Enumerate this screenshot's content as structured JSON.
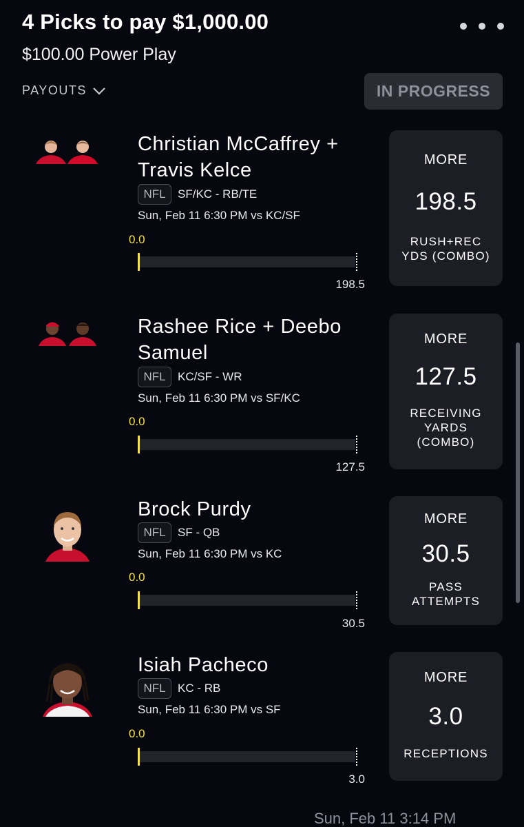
{
  "header": {
    "title": "4 Picks to pay $1,000.00",
    "subtitle": "$100.00 Power Play",
    "payouts_label": "PAYOUTS",
    "status": "IN PROGRESS"
  },
  "picks": [
    {
      "player": "Christian McCaffrey + Travis Kelce",
      "league": "NFL",
      "team_pos": "SF/KC - RB/TE",
      "game": "Sun, Feb 11 6:30 PM  vs KC/SF",
      "current": "0.0",
      "target": "198.5",
      "direction": "MORE",
      "line": "198.5",
      "stat": "RUSH+REC YDS (COMBO)"
    },
    {
      "player": "Rashee Rice + Deebo Samuel",
      "league": "NFL",
      "team_pos": "KC/SF - WR",
      "game": "Sun, Feb 11 6:30 PM  vs SF/KC",
      "current": "0.0",
      "target": "127.5",
      "direction": "MORE",
      "line": "127.5",
      "stat": "RECEIVING YARDS (COMBO)"
    },
    {
      "player": "Brock Purdy",
      "league": "NFL",
      "team_pos": "SF - QB",
      "game": "Sun, Feb 11 6:30 PM  vs KC",
      "current": "0.0",
      "target": "30.5",
      "direction": "MORE",
      "line": "30.5",
      "stat": "PASS ATTEMPTS"
    },
    {
      "player": "Isiah Pacheco",
      "league": "NFL",
      "team_pos": "KC - RB",
      "game": "Sun, Feb 11 6:30 PM  vs SF",
      "current": "0.0",
      "target": "3.0",
      "direction": "MORE",
      "line": "3.0",
      "stat": "RECEPTIONS"
    }
  ],
  "footer": {
    "timestamp": "Sun, Feb 11 3:14 PM"
  },
  "colors": {
    "background": "#07070f",
    "card": "#1c1d25",
    "progress_accent": "#f3e24a",
    "status_badge": "#2a2b33"
  },
  "icons": [
    "more-horizontal-icon",
    "chevron-down-icon"
  ]
}
